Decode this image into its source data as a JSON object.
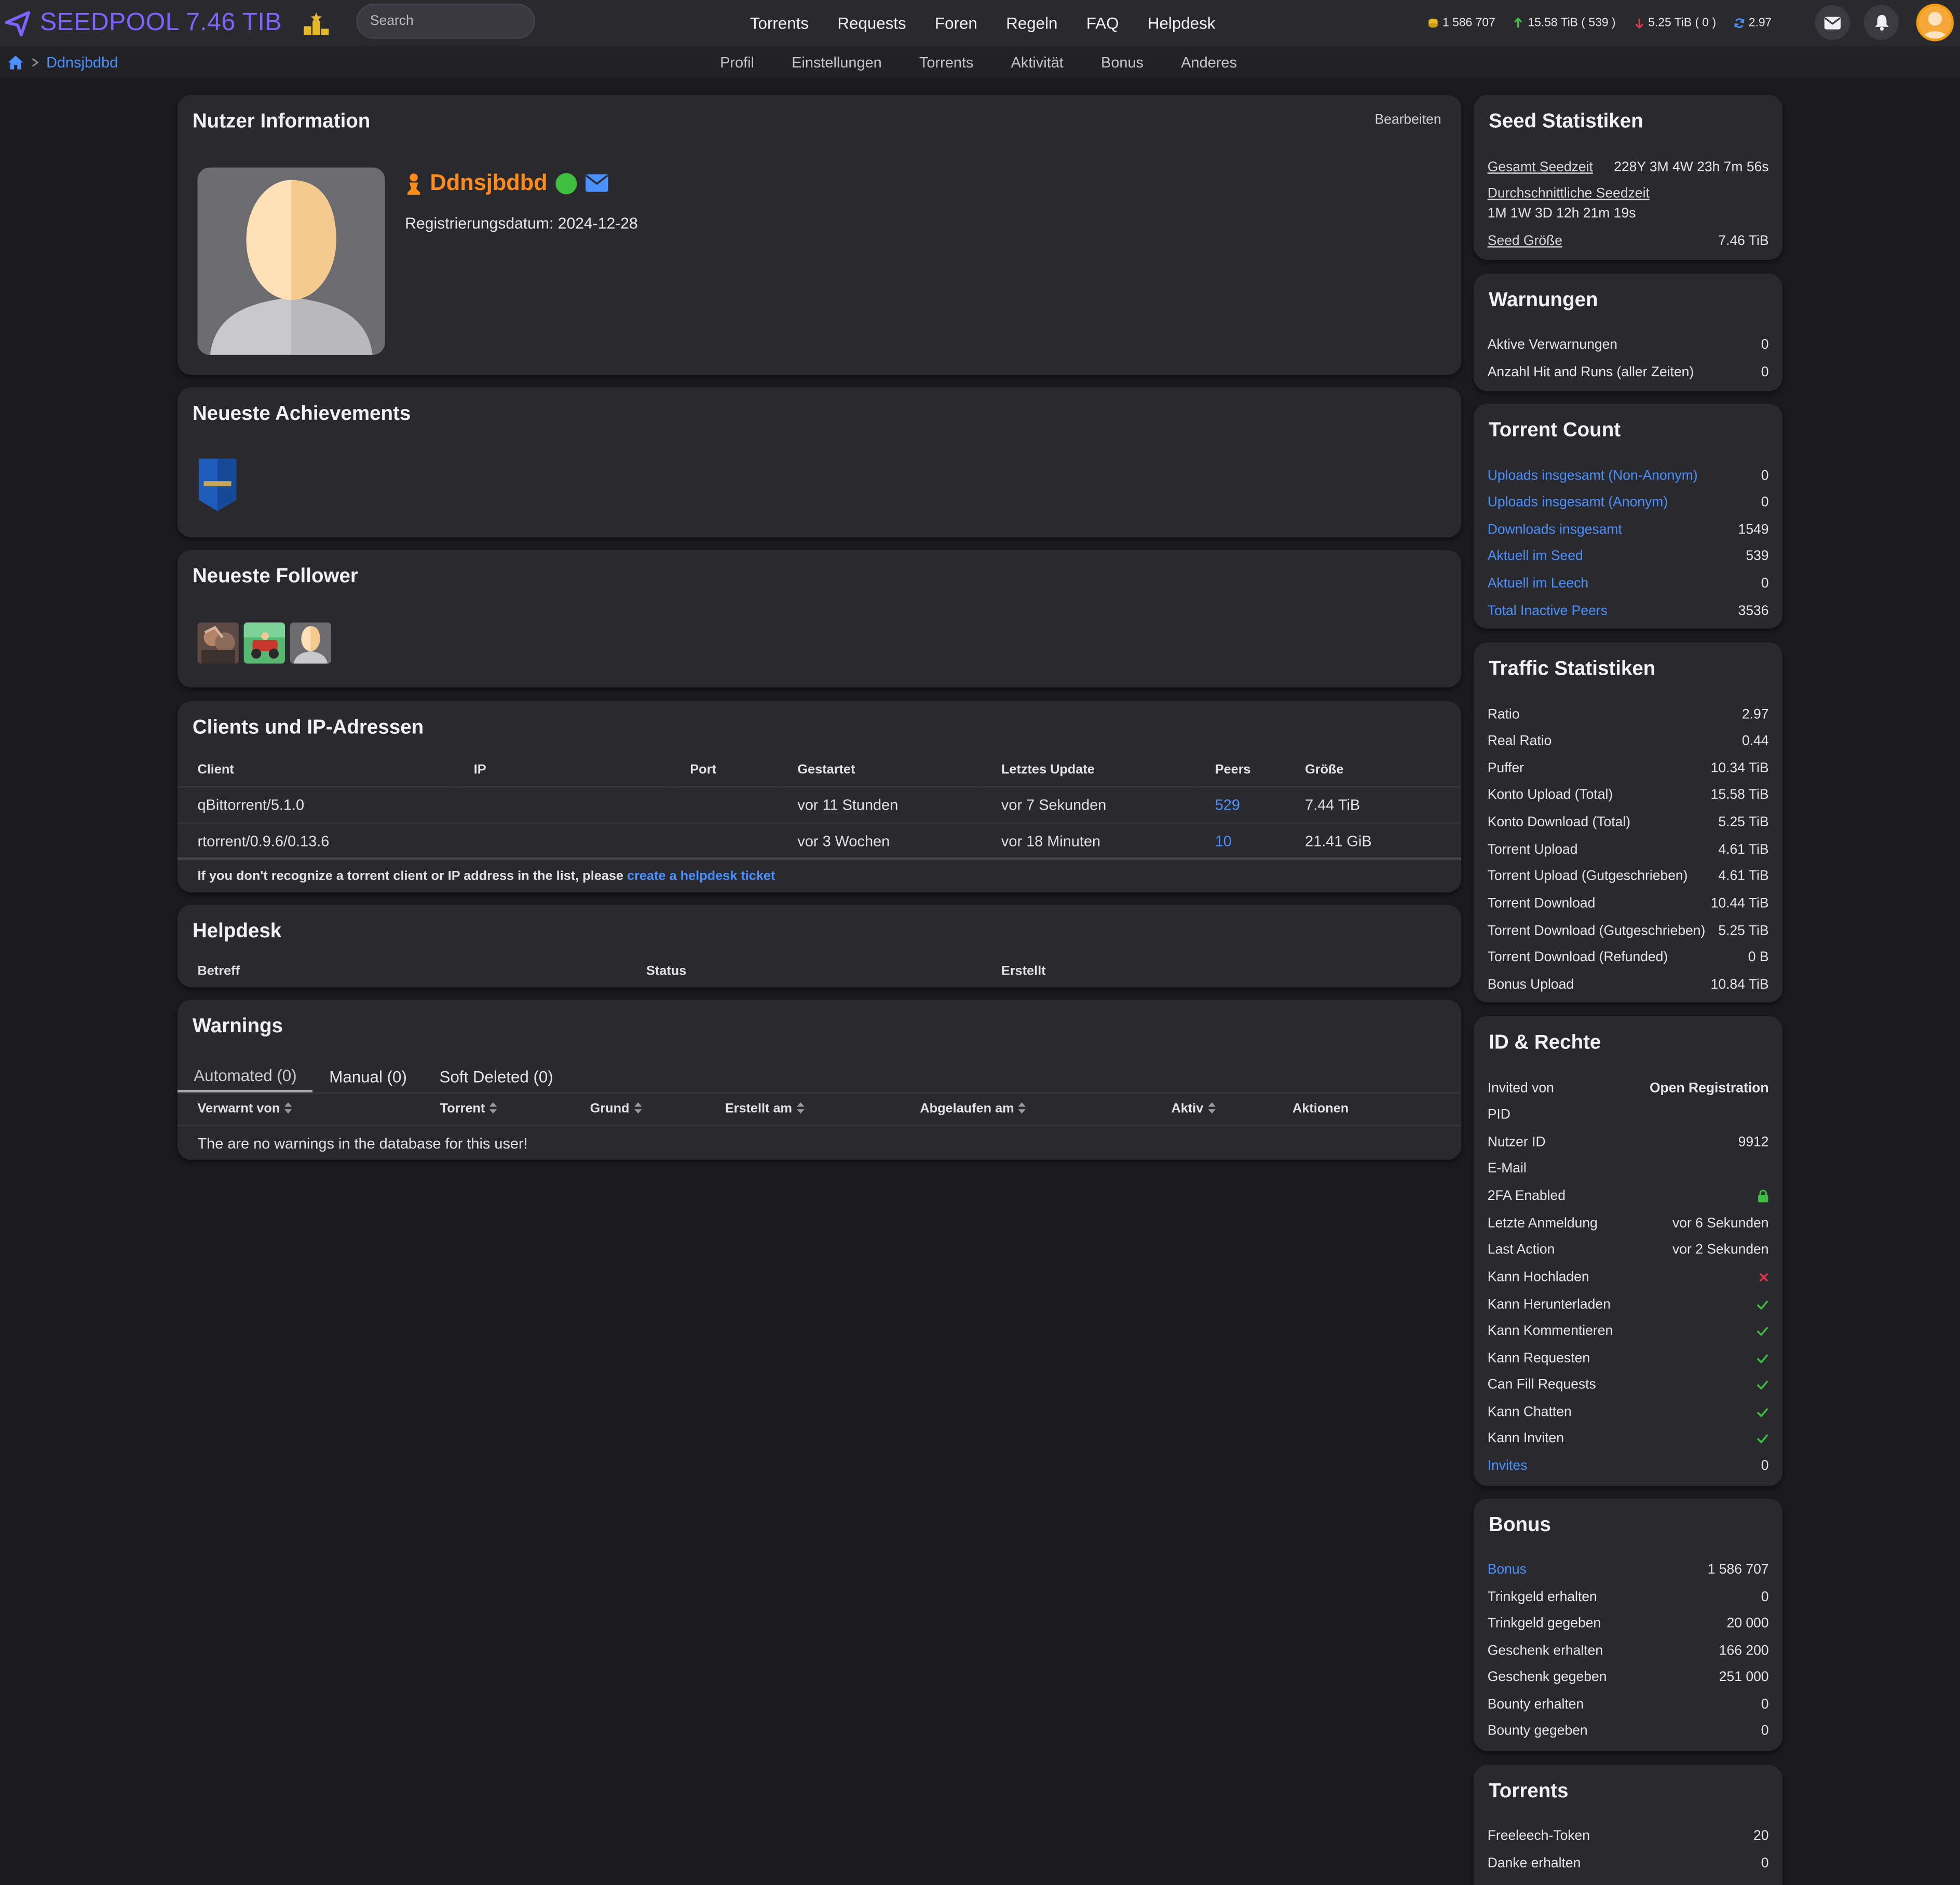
{
  "brand": {
    "name": "SEEDPOOL 7.46 TIB",
    "accent": "#7d63ff"
  },
  "search": {
    "placeholder": "Search"
  },
  "nav": [
    "Torrents",
    "Requests",
    "Foren",
    "Regeln",
    "FAQ",
    "Helpdesk"
  ],
  "stats": {
    "bonus": "1 586 707",
    "upload": "15.58 TiB ( 539 )",
    "download": "5.25 TiB ( 0 )",
    "ratio": "2.97"
  },
  "breadcrumb": {
    "user": "Ddnsjbdbd"
  },
  "subnav": [
    "Profil",
    "Einstellungen",
    "Torrents",
    "Aktivität",
    "Bonus",
    "Anderes"
  ],
  "user_info": {
    "title": "Nutzer Information",
    "edit": "Bearbeiten",
    "username": "Ddnsjbdbd",
    "reg_date": "Registrierungsdatum: 2024-12-28"
  },
  "achievements": {
    "title": "Neueste Achievements"
  },
  "followers": {
    "title": "Neueste Follower"
  },
  "clients": {
    "title": "Clients und IP-Adressen",
    "headers": [
      "Client",
      "IP",
      "Port",
      "Gestartet",
      "Letztes Update",
      "Peers",
      "Größe"
    ],
    "rows": [
      [
        "qBittorrent/5.1.0",
        "",
        "",
        "vor 11 Stunden",
        "vor 7 Sekunden",
        "529",
        "7.44 TiB"
      ],
      [
        "rtorrent/0.9.6/0.13.6",
        "",
        "",
        "vor 3 Wochen",
        "vor 18 Minuten",
        "10",
        "21.41 GiB"
      ]
    ],
    "note": "If you don't recognize a torrent client or IP address in the list, please ",
    "note_link": "create a helpdesk ticket"
  },
  "helpdesk": {
    "title": "Helpdesk",
    "headers": [
      "Betreff",
      "Status",
      "Erstellt"
    ]
  },
  "warnings": {
    "title": "Warnings",
    "tabs": [
      "Automated (0)",
      "Manual (0)",
      "Soft Deleted (0)"
    ],
    "headers": [
      "Verwarnt von",
      "Torrent",
      "Grund",
      "Erstellt am",
      "Abgelaufen am",
      "Aktiv",
      "Aktionen"
    ],
    "empty": "The are no warnings in the database for this user!"
  },
  "seed_stats": {
    "title": "Seed Statistiken",
    "total_label": "Gesamt Seedzeit",
    "total": "228Y 3M 4W 23h 7m 56s",
    "avg_label": "Durchschnittliche Seedzeit",
    "avg": "1M 1W 3D 12h 21m 19s",
    "size_label": "Seed Größe",
    "size": "7.46 TiB"
  },
  "warnungen": {
    "title": "Warnungen",
    "rows": [
      [
        "Aktive Verwarnungen",
        "0"
      ],
      [
        "Anzahl Hit and Runs (aller Zeiten)",
        "0"
      ]
    ]
  },
  "torrent_count": {
    "title": "Torrent Count",
    "rows": [
      [
        "Uploads insgesamt (Non-Anonym)",
        "0"
      ],
      [
        "Uploads insgesamt (Anonym)",
        "0"
      ],
      [
        "Downloads insgesamt",
        "1549"
      ],
      [
        "Aktuell im Seed",
        "539"
      ],
      [
        "Aktuell im Leech",
        "0"
      ],
      [
        "Total Inactive Peers",
        "3536"
      ]
    ]
  },
  "traffic": {
    "title": "Traffic Statistiken",
    "rows": [
      [
        "Ratio",
        "2.97"
      ],
      [
        "Real Ratio",
        "0.44"
      ],
      [
        "Puffer",
        "10.34 TiB"
      ],
      [
        "Konto Upload (Total)",
        "15.58 TiB"
      ],
      [
        "Konto Download (Total)",
        "5.25 TiB"
      ],
      [
        "Torrent Upload",
        "4.61 TiB"
      ],
      [
        "Torrent Upload (Gutgeschrieben)",
        "4.61 TiB"
      ],
      [
        "Torrent Download",
        "10.44 TiB"
      ],
      [
        "Torrent Download (Gutgeschrieben)",
        "5.25 TiB"
      ],
      [
        "Torrent Download (Refunded)",
        "0 B"
      ],
      [
        "Bonus Upload",
        "10.84 TiB"
      ]
    ]
  },
  "rights": {
    "title": "ID & Rechte",
    "rows": [
      [
        "Invited von",
        "Open Registration"
      ],
      [
        "PID",
        ""
      ],
      [
        "Nutzer ID",
        "9912"
      ],
      [
        "E-Mail",
        ""
      ],
      [
        "2FA Enabled",
        ""
      ],
      [
        "Letzte Anmeldung",
        "vor 6 Sekunden"
      ],
      [
        "Last Action",
        "vor 2 Sekunden"
      ],
      [
        "Kann Hochladen",
        ""
      ],
      [
        "Kann Herunterladen",
        ""
      ],
      [
        "Kann Kommentieren",
        ""
      ],
      [
        "Kann Requesten",
        ""
      ],
      [
        "Can Fill Requests",
        ""
      ],
      [
        "Kann Chatten",
        ""
      ],
      [
        "Kann Inviten",
        ""
      ],
      [
        "Invites",
        "0"
      ]
    ]
  },
  "bonus": {
    "title": "Bonus",
    "rows": [
      [
        "Bonus",
        "1 586 707"
      ],
      [
        "Trinkgeld erhalten",
        "0"
      ],
      [
        "Trinkgeld gegeben",
        "20 000"
      ],
      [
        "Geschenk erhalten",
        "166 200"
      ],
      [
        "Geschenk gegeben",
        "251 000"
      ],
      [
        "Bounty erhalten",
        "0"
      ],
      [
        "Bounty gegeben",
        "0"
      ]
    ]
  },
  "torrents_card": {
    "title": "Torrents",
    "rows": [
      [
        "Freeleech-Token",
        "20"
      ],
      [
        "Danke erhalten",
        "0"
      ]
    ]
  }
}
